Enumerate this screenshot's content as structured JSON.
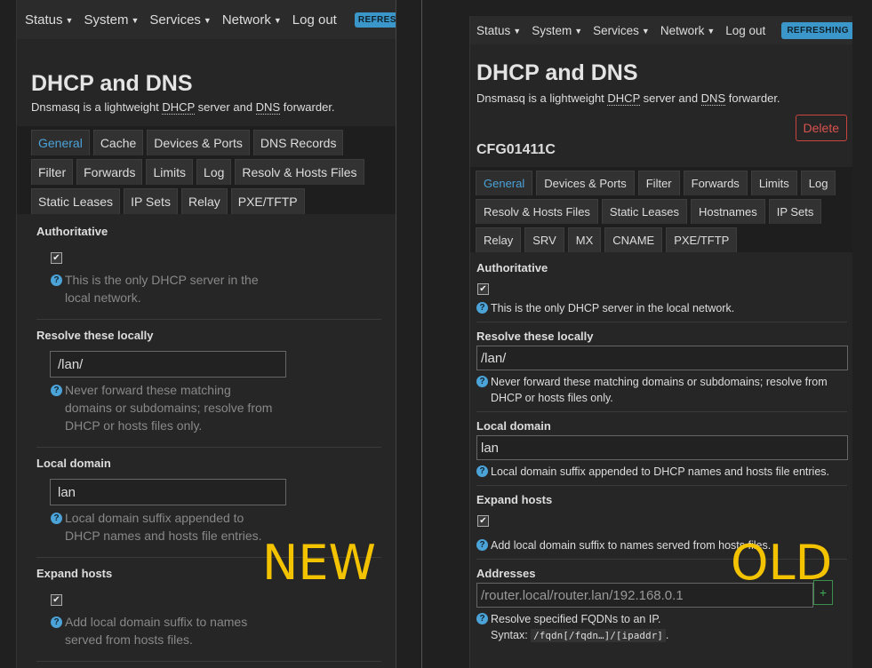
{
  "menu": [
    {
      "label": "Status"
    },
    {
      "label": "System"
    },
    {
      "label": "Services"
    },
    {
      "label": "Network"
    }
  ],
  "logout": "Log out",
  "badge_new": "REFRESHING",
  "badge_old": "REFRESHING",
  "title": "DHCP and DNS",
  "desc": {
    "p1": "Dnsmasq is a lightweight ",
    "dhcp": "DHCP",
    "p2": " server and ",
    "dns": "DNS",
    "p3": " forwarder."
  },
  "new_panel": {
    "tab_rows": [
      [
        "General",
        "Cache",
        "Devices & Ports",
        "DNS Records"
      ],
      [
        "Filter",
        "Forwards",
        "Limits",
        "Log",
        "Resolv & Hosts Files"
      ],
      [
        "Static Leases",
        "IP Sets",
        "Relay",
        "PXE/TFTP"
      ]
    ],
    "authoritative": {
      "label": "Authoritative",
      "help": "This is the only DHCP server in the local network."
    },
    "resolve": {
      "label": "Resolve these locally",
      "value": "/lan/",
      "help": "Never forward these matching domains or subdomains; resolve from DHCP or hosts files only."
    },
    "domain": {
      "label": "Local domain",
      "value": "lan",
      "help": "Local domain suffix appended to DHCP names and hosts file entries."
    },
    "expand": {
      "label": "Expand hosts",
      "help": "Add local domain suffix to names served from hosts files."
    }
  },
  "old_panel": {
    "delete": "Delete",
    "config_name": "CFG01411C",
    "tab_rows": [
      [
        "General",
        "Devices & Ports",
        "Filter",
        "Forwards",
        "Limits",
        "Log"
      ],
      [
        "Resolv & Hosts Files",
        "Static Leases",
        "Hostnames",
        "IP Sets"
      ],
      [
        "Relay",
        "SRV",
        "MX",
        "CNAME",
        "PXE/TFTP"
      ]
    ],
    "authoritative": {
      "label": "Authoritative",
      "help": "This is the only DHCP server in the local network."
    },
    "resolve": {
      "label": "Resolve these locally",
      "value": "/lan/",
      "help": "Never forward these matching domains or subdomains; resolve from DHCP or hosts files only."
    },
    "domain": {
      "label": "Local domain",
      "value": "lan",
      "help": "Local domain suffix appended to DHCP names and hosts file entries."
    },
    "expand": {
      "label": "Expand hosts",
      "help": "Add local domain suffix to names served from hosts files."
    },
    "addresses": {
      "label": "Addresses",
      "value": "/router.local/router.lan/192.168.0.1",
      "help": "Resolve specified FQDNs to an IP.",
      "syntax_label": "Syntax:",
      "syntax": "/fqdn[/fqdn…]/[ipaddr]",
      "syntax_end": "."
    }
  },
  "labels": {
    "new": "NEW",
    "old": "OLD"
  },
  "icons": {
    "checkbox": "checkmark-icon",
    "help": "help-icon",
    "caret": "caret-down-icon",
    "plus": "plus-icon"
  }
}
